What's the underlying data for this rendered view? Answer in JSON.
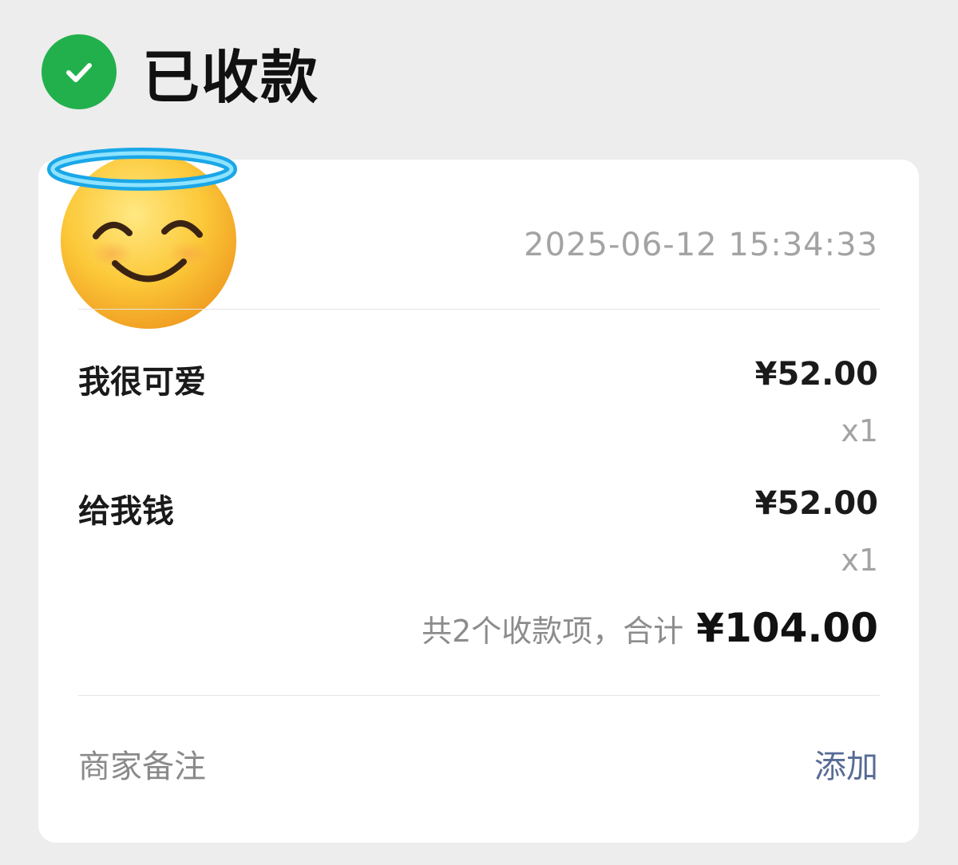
{
  "status": {
    "icon": "check-circle-icon",
    "title": "已收款",
    "color": "#22b04c"
  },
  "avatar": {
    "icon": "smiling-face-with-halo-icon"
  },
  "receipt": {
    "datetime": "2025-06-12 15:34:33",
    "items": [
      {
        "name": "我很可爱",
        "price": "¥52.00",
        "qty": "x1"
      },
      {
        "name": "给我钱",
        "price": "¥52.00",
        "qty": "x1"
      }
    ],
    "summary_label": "共2个收款项，合计",
    "total": "¥104.00"
  },
  "remark": {
    "label": "商家备注",
    "action": "添加",
    "action_color": "#576b95"
  }
}
